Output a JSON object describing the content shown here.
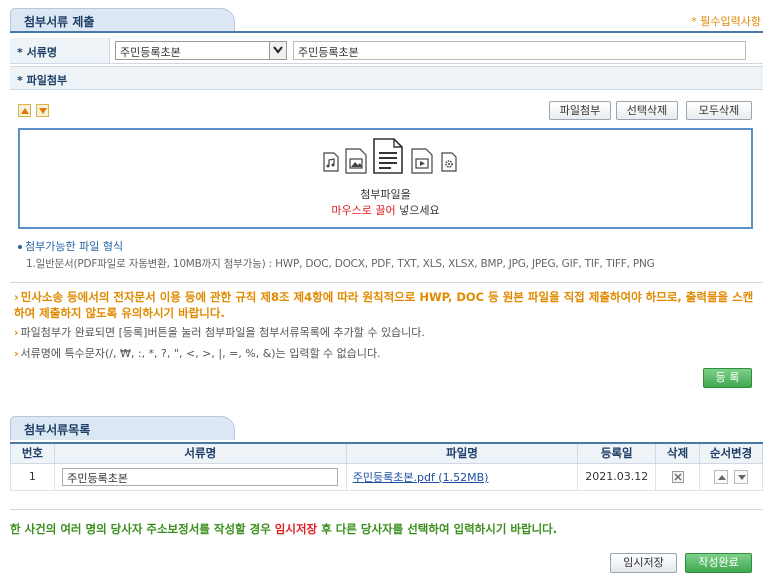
{
  "submit_section": {
    "title": "첨부서류 제출",
    "required_note": "* 필수입력사항",
    "doc_name_label": "* 서류명",
    "doc_type_selected": "주민등록초본",
    "doc_name_value": "주민등록초본",
    "file_attach_label": "* 파일첨부",
    "buttons": {
      "attach": "파일첨부",
      "delete_selected": "선택삭제",
      "delete_all": "모두삭제"
    },
    "dropzone": {
      "line1": "첨부파일을",
      "line2_red": "마우스로 끌어",
      "line2_rest": " 넣으세요"
    },
    "formats_title": "첨부가능한 파일 형식",
    "formats_list": "1.일반문서(PDF파일로 자동변환, 10MB까지 첨부가능) : HWP, DOC, DOCX, PDF, TXT, XLS, XLSX, BMP, JPG, JPEG, GIF, TIF, TIFF, PNG",
    "notes": {
      "warn": "민사소송 등에서의 전자문서 이용 등에 관한 규칙 제8조 제4항에 따라 원칙적으로 HWP, DOC 등 원본 파일을 직접 제출하여야 하므로, 출력물을 스캔하여 제출하지 않도록 유의하시기 바랍니다.",
      "note1": "파일첨부가 완료되면 [등록]버튼을 눌러 첨부파일을 첨부서류목록에 추가할 수 있습니다.",
      "note2": "서류명에 특수문자(/, ₩, :, *, ?, \", <, >, |, =, %, &)는 입력할 수 없습니다."
    },
    "register_button": "등 록"
  },
  "list_section": {
    "title": "첨부서류목록",
    "columns": [
      "번호",
      "서류명",
      "파일명",
      "등록일",
      "삭제",
      "순서변경"
    ],
    "rows": [
      {
        "no": "1",
        "doc_name": "주민등록초본",
        "file_name": "주민등록초본.pdf (1.52MB)",
        "date": "2021.03.12"
      }
    ]
  },
  "bottom": {
    "note_pre": "한 사건의 여러 명의 당사자 주소보정서를 작성할 경우 ",
    "note_red": "임시저장",
    "note_post": " 후 다른 당사자를 선택하여 입력하시기 바랍니다.",
    "temp_save": "임시저장",
    "complete": "작성완료"
  },
  "colors": {
    "accent_blue": "#4a79a8",
    "orange": "#e08a00",
    "green": "#3fa84f",
    "red": "#e02020"
  }
}
